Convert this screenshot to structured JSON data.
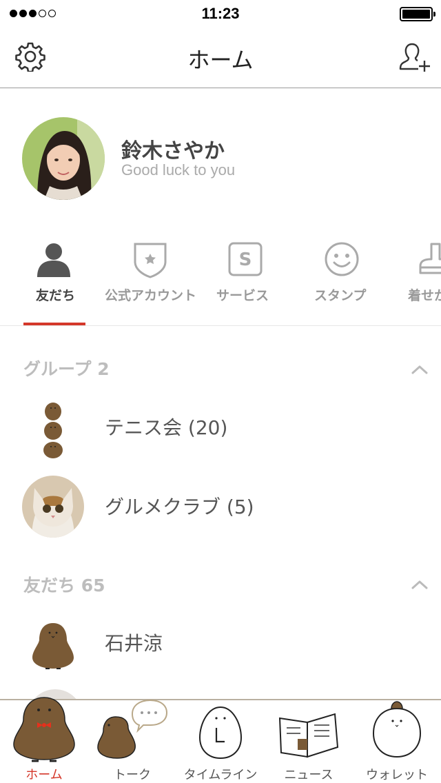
{
  "status_bar": {
    "time": "11:23",
    "signal_bars": 3,
    "signal_total": 5,
    "battery_level": 1.0
  },
  "nav": {
    "title": "ホーム",
    "settings_icon": "gear-icon",
    "add_friend_icon": "add-friend-icon"
  },
  "profile": {
    "name": "鈴木さやか",
    "status": "Good luck to you"
  },
  "tabs": [
    {
      "label": "友だち",
      "icon": "person-icon",
      "active": true
    },
    {
      "label": "公式アカウント",
      "icon": "shield-star-icon",
      "active": false
    },
    {
      "label": "サービス",
      "icon": "service-s-icon",
      "active": false
    },
    {
      "label": "スタンプ",
      "icon": "smiley-icon",
      "active": false
    },
    {
      "label": "着せか",
      "icon": "theme-icon",
      "active": false
    }
  ],
  "groups": {
    "header": "グループ 2",
    "items": [
      {
        "label": "テニス会 (20)"
      },
      {
        "label": "グルメクラブ (5)"
      }
    ]
  },
  "friends": {
    "header": "友だち 65",
    "items": [
      {
        "label": "石井涼"
      }
    ]
  },
  "tabbar": [
    {
      "label": "ホーム",
      "active": true
    },
    {
      "label": "トーク",
      "active": false
    },
    {
      "label": "タイムライン",
      "active": false
    },
    {
      "label": "ニュース",
      "active": false
    },
    {
      "label": "ウォレット",
      "active": false
    }
  ],
  "colors": {
    "accent": "#d4372a",
    "bird": "#7a5a36",
    "section_header": "#bdbdbd"
  }
}
